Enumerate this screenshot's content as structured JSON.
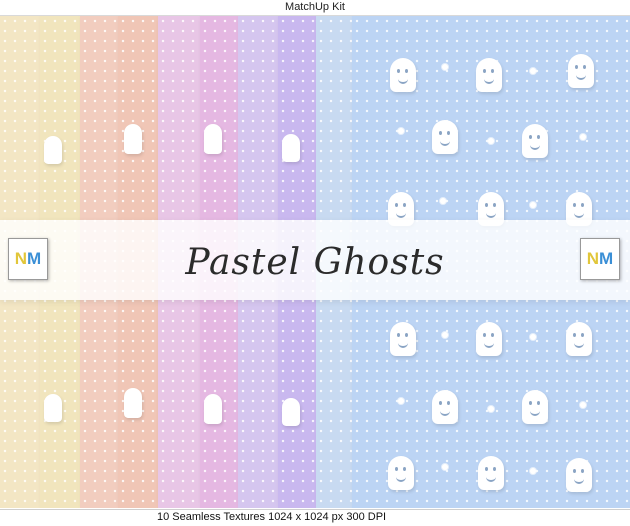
{
  "window": {
    "title": "MatchUp Kit"
  },
  "banner": {
    "title": "Pastel Ghosts",
    "logo_letter_1": "N",
    "logo_letter_2": "M"
  },
  "caption": {
    "text": "10 Seamless Textures   1024 x 1024 px 300 DPI"
  },
  "colors": {
    "papers": [
      "#f3e6c4",
      "#f1e5bd",
      "#f2cdbf",
      "#f0c6b6",
      "#e8c6e6",
      "#e5b8e2",
      "#d5c6ef",
      "#c9b8ef",
      "#c8daf1",
      "#bcd4f4"
    ],
    "logo_n": "#e1c63a",
    "logo_m": "#3a8fd6"
  }
}
